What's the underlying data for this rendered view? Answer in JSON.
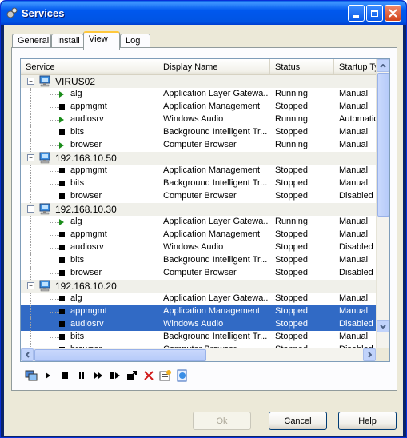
{
  "window": {
    "title": "Services"
  },
  "tabs": [
    {
      "label": "General"
    },
    {
      "label": "Install"
    },
    {
      "label": "View"
    },
    {
      "label": "Log"
    }
  ],
  "columns": {
    "service": "Service",
    "display": "Display Name",
    "status": "Status",
    "startup": "Startup Type"
  },
  "groups": [
    {
      "host": "VIRUS02",
      "rows": [
        {
          "service": "alg",
          "display": "Application Layer Gatewa...",
          "status": "Running",
          "startup": "Manual",
          "state": "run"
        },
        {
          "service": "appmgmt",
          "display": "Application Management",
          "status": "Stopped",
          "startup": "Manual",
          "state": "stop"
        },
        {
          "service": "audiosrv",
          "display": "Windows Audio",
          "status": "Running",
          "startup": "Automatic",
          "state": "run"
        },
        {
          "service": "bits",
          "display": "Background Intelligent Tr...",
          "status": "Stopped",
          "startup": "Manual",
          "state": "stop"
        },
        {
          "service": "browser",
          "display": "Computer Browser",
          "status": "Running",
          "startup": "Manual",
          "state": "run"
        }
      ]
    },
    {
      "host": "192.168.10.50",
      "rows": [
        {
          "service": "appmgmt",
          "display": "Application Management",
          "status": "Stopped",
          "startup": "Manual",
          "state": "stop"
        },
        {
          "service": "bits",
          "display": "Background Intelligent Tr...",
          "status": "Stopped",
          "startup": "Manual",
          "state": "stop"
        },
        {
          "service": "browser",
          "display": "Computer Browser",
          "status": "Stopped",
          "startup": "Disabled",
          "state": "stop"
        }
      ]
    },
    {
      "host": "192.168.10.30",
      "rows": [
        {
          "service": "alg",
          "display": "Application Layer Gatewa...",
          "status": "Running",
          "startup": "Manual",
          "state": "run"
        },
        {
          "service": "appmgmt",
          "display": "Application Management",
          "status": "Stopped",
          "startup": "Manual",
          "state": "stop"
        },
        {
          "service": "audiosrv",
          "display": "Windows Audio",
          "status": "Stopped",
          "startup": "Disabled",
          "state": "stop"
        },
        {
          "service": "bits",
          "display": "Background Intelligent Tr...",
          "status": "Stopped",
          "startup": "Manual",
          "state": "stop"
        },
        {
          "service": "browser",
          "display": "Computer Browser",
          "status": "Stopped",
          "startup": "Disabled",
          "state": "stop"
        }
      ]
    },
    {
      "host": "192.168.10.20",
      "rows": [
        {
          "service": "alg",
          "display": "Application Layer Gatewa...",
          "status": "Stopped",
          "startup": "Manual",
          "state": "stop"
        },
        {
          "service": "appmgmt",
          "display": "Application Management",
          "status": "Stopped",
          "startup": "Manual",
          "state": "stop",
          "selected": true
        },
        {
          "service": "audiosrv",
          "display": "Windows Audio",
          "status": "Stopped",
          "startup": "Disabled",
          "state": "stop",
          "selected": true
        },
        {
          "service": "bits",
          "display": "Background Intelligent Tr...",
          "status": "Stopped",
          "startup": "Manual",
          "state": "stop"
        },
        {
          "service": "browser",
          "display": "Computer Browser",
          "status": "Stopped",
          "startup": "Disabled",
          "state": "stop"
        }
      ]
    }
  ],
  "toolbar": [
    {
      "name": "connect-icon"
    },
    {
      "name": "start-icon"
    },
    {
      "name": "stop-icon"
    },
    {
      "name": "pause-icon"
    },
    {
      "name": "resume-icon"
    },
    {
      "name": "restart-icon"
    },
    {
      "name": "jump-icon"
    },
    {
      "name": "delete-icon"
    },
    {
      "name": "properties-icon"
    },
    {
      "name": "browse-icon"
    }
  ],
  "buttons": {
    "ok": "Ok",
    "cancel": "Cancel",
    "help": "Help"
  },
  "colors": {
    "selection": "#316ac5",
    "running": "#1a8c1a",
    "titlebar": "#0054e3"
  }
}
